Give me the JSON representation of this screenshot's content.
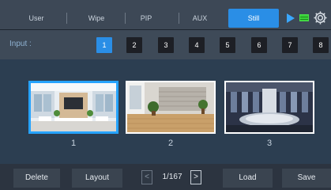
{
  "tabs": [
    {
      "label": "User",
      "active": false
    },
    {
      "label": "Wipe",
      "active": false
    },
    {
      "label": "PIP",
      "active": false
    },
    {
      "label": "AUX",
      "active": false
    },
    {
      "label": "Still",
      "active": true
    }
  ],
  "icons": {
    "play": "play-icon",
    "status": "green-bars-icon",
    "settings": "gear-icon"
  },
  "input": {
    "label": "Input :",
    "numbers": [
      "1",
      "2",
      "3",
      "4",
      "5",
      "6",
      "7",
      "8"
    ],
    "active": "1"
  },
  "stills": [
    {
      "caption": "1",
      "selected": true
    },
    {
      "caption": "2",
      "selected": false
    },
    {
      "caption": "3",
      "selected": false
    }
  ],
  "bottom": {
    "delete_label": "Delete",
    "layout_label": "Layout",
    "prev_glyph": "<",
    "page_text": "1/167",
    "next_glyph": ">",
    "load_label": "Load",
    "save_label": "Save"
  },
  "colors": {
    "accent": "#2a8ee6",
    "selection": "#26a3ff"
  }
}
